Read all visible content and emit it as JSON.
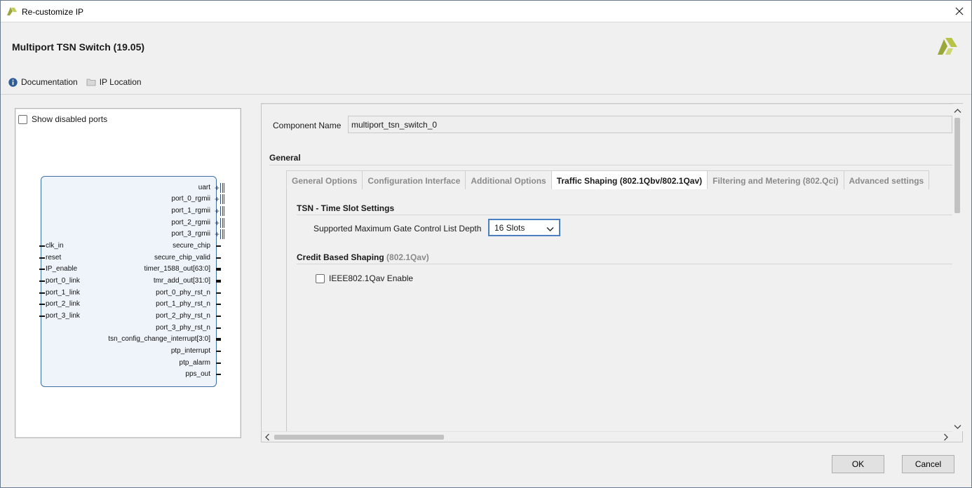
{
  "window": {
    "title": "Re-customize IP"
  },
  "header": {
    "ip_title": "Multiport TSN Switch (19.05)",
    "links": [
      {
        "label": "Documentation",
        "icon": "info-icon"
      },
      {
        "label": "IP Location",
        "icon": "folder-icon"
      }
    ]
  },
  "symbol_panel": {
    "show_disabled_ports_label": "Show disabled ports",
    "show_disabled_ports_checked": false,
    "left_ports": [
      "clk_in",
      "reset",
      "IP_enable",
      "port_0_link",
      "port_1_link",
      "port_2_link",
      "port_3_link"
    ],
    "right_ports": [
      {
        "name": "uart",
        "type": "interface"
      },
      {
        "name": "port_0_rgmii",
        "type": "interface"
      },
      {
        "name": "port_1_rgmii",
        "type": "interface"
      },
      {
        "name": "port_2_rgmii",
        "type": "interface"
      },
      {
        "name": "port_3_rgmii",
        "type": "interface"
      },
      {
        "name": "secure_chip",
        "type": "single"
      },
      {
        "name": "secure_chip_valid",
        "type": "single"
      },
      {
        "name": "timer_1588_out[63:0]",
        "type": "bus"
      },
      {
        "name": "tmr_add_out[31:0]",
        "type": "bus"
      },
      {
        "name": "port_0_phy_rst_n",
        "type": "single"
      },
      {
        "name": "port_1_phy_rst_n",
        "type": "single"
      },
      {
        "name": "port_2_phy_rst_n",
        "type": "single"
      },
      {
        "name": "port_3_phy_rst_n",
        "type": "single"
      },
      {
        "name": "tsn_config_change_interrupt[3:0]",
        "type": "bus"
      },
      {
        "name": "ptp_interrupt",
        "type": "single"
      },
      {
        "name": "ptp_alarm",
        "type": "single"
      },
      {
        "name": "pps_out",
        "type": "single"
      }
    ]
  },
  "config": {
    "component_name_label": "Component Name",
    "component_name_value": "multiport_tsn_switch_0",
    "general_label": "General",
    "tabs": [
      {
        "label": "General Options",
        "active": false
      },
      {
        "label": "Configuration Interface",
        "active": false
      },
      {
        "label": "Additional Options",
        "active": false
      },
      {
        "label": "Traffic Shaping (802.1Qbv/802.1Qav)",
        "active": true
      },
      {
        "label": "Filtering and Metering (802.Qci)",
        "active": false
      },
      {
        "label": "Advanced settings",
        "active": false
      }
    ],
    "tsn_section": {
      "title": "TSN - Time Slot Settings",
      "gate_label": "Supported Maximum Gate Control List Depth",
      "gate_value": "16 Slots"
    },
    "cbs_section": {
      "title": "Credit Based Shaping",
      "title_suffix": "(802.1Qav)",
      "enable_label": "IEEE802.1Qav Enable",
      "enable_checked": false
    }
  },
  "buttons": {
    "ok": "OK",
    "cancel": "Cancel"
  },
  "colors": {
    "accent": "#4a7fc1",
    "block_fill": "#eef4fa",
    "block_border": "#3f6fa3",
    "logo": "#a7b531"
  }
}
